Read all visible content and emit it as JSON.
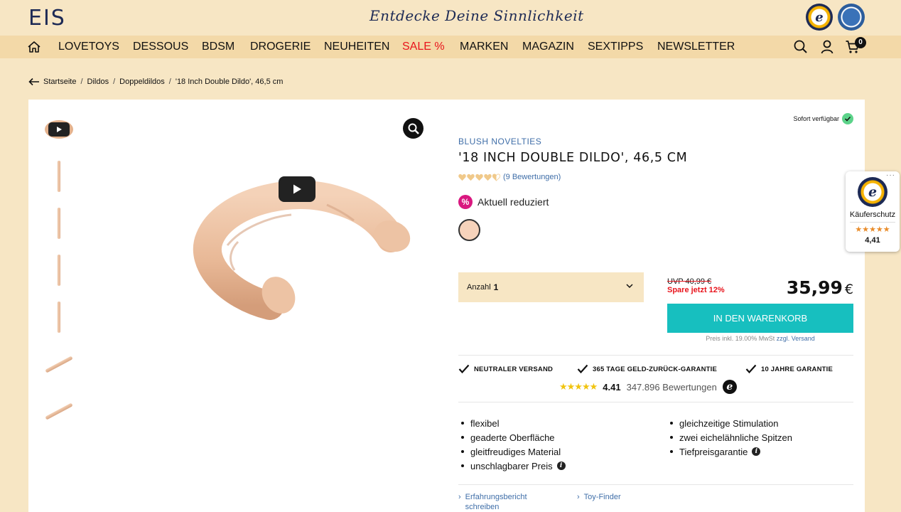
{
  "header": {
    "logo": "EIS",
    "tagline": "Entdecke Deine Sinnlichkeit",
    "seal_letter": "e"
  },
  "nav": {
    "items": [
      "LOVETOYS",
      "DESSOUS",
      "BDSM",
      "DROGERIE",
      "NEUHEITEN",
      "SALE %",
      "MARKEN",
      "MAGAZIN",
      "SEXTIPPS",
      "NEWSLETTER"
    ],
    "cart_count": "0",
    "sale_color": "#e8141c"
  },
  "breadcrumb": [
    "Startseite",
    "Dildos",
    "Doppeldildos",
    "'18 Inch Double Dildo', 46,5 cm"
  ],
  "product": {
    "availability": "Sofort verfügbar",
    "brand": "BLUSH NOVELTIES",
    "title": "'18 INCH DOUBLE DILDO', 46,5 CM",
    "rating_hearts": 4.5,
    "rating_text": "(9 Bewertungen)",
    "reduced_label": "Aktuell reduziert",
    "reduced_icon": "%",
    "swatch_color": "#f6d3bb",
    "quantity_label": "Anzahl",
    "quantity_value": "1",
    "uvp": "UVP 40,99 €",
    "save": "Spare jetzt 12%",
    "price": "35,99",
    "currency": "€",
    "cart_button": "IN DEN WARENKORB",
    "vat_text": "Preis inkl. 19.00% MwSt",
    "vat_shipping_prefix": "zzgl.",
    "vat_shipping_link": "Versand"
  },
  "guarantees": [
    "NEUTRALER VERSAND",
    "365 TAGE GELD-ZURÜCK-GARANTIE",
    "10 JAHRE GARANTIE"
  ],
  "trust": {
    "stars": "★★★★★",
    "score": "4.41",
    "count": "347.896 Bewertungen",
    "badge": "e"
  },
  "features_left": [
    "flexibel",
    "geaderte Oberfläche",
    "gleitfreudiges Material",
    "unschlagbarer Preis"
  ],
  "features_right": [
    "gleichzeitige Stimulation",
    "zwei eichelähnliche Spitzen",
    "Tiefpreisgarantie"
  ],
  "info_icon": "i",
  "bottom_links": [
    {
      "line1": "Erfahrungsbericht",
      "line2": "schreiben"
    },
    {
      "line1": "Toy-Finder",
      "line2": ""
    }
  ],
  "ts_widget": {
    "seal_letter": "e",
    "label": "Käuferschutz",
    "stars": "★★★★★",
    "score": "4,41"
  },
  "thumbnails": [
    "video-thumb",
    "side-view-1",
    "side-view-2",
    "side-view-3",
    "side-view-4",
    "diagonal-view-1",
    "diagonal-view-2"
  ]
}
